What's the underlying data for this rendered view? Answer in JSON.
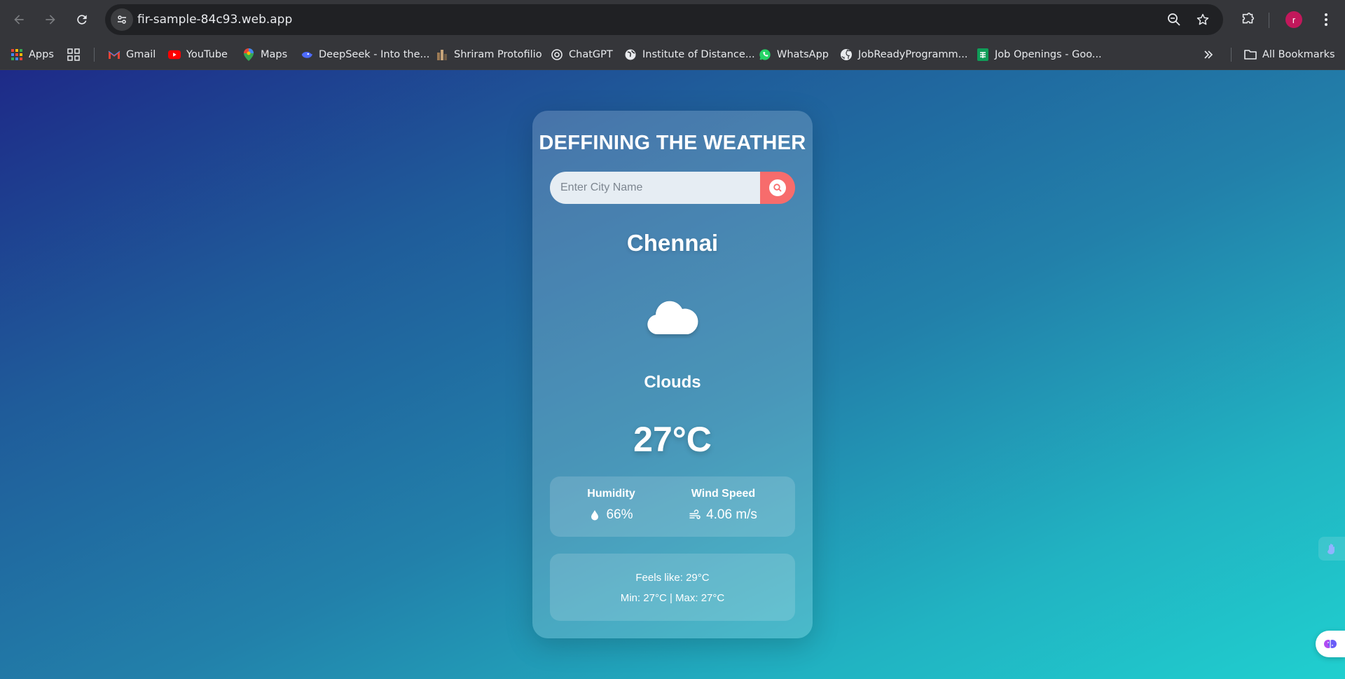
{
  "browser": {
    "url": "fir-sample-84c93.web.app",
    "profile_initial": "r"
  },
  "bookmarks": {
    "apps_label": "Apps",
    "items": [
      {
        "label": "Gmail",
        "icon": "gmail-icon"
      },
      {
        "label": "YouTube",
        "icon": "youtube-icon"
      },
      {
        "label": "Maps",
        "icon": "maps-icon"
      },
      {
        "label": "DeepSeek - Into the...",
        "icon": "deepseek-icon"
      },
      {
        "label": "Shriram Protofilio",
        "icon": "portfolio-icon"
      },
      {
        "label": "ChatGPT",
        "icon": "chatgpt-icon"
      },
      {
        "label": "Institute of Distance...",
        "icon": "globe-icon"
      },
      {
        "label": "WhatsApp",
        "icon": "whatsapp-icon"
      },
      {
        "label": "JobReadyProgramm...",
        "icon": "github-icon"
      },
      {
        "label": "Job Openings - Goo...",
        "icon": "sheets-icon"
      }
    ],
    "all_bookmarks_label": "All Bookmarks"
  },
  "app": {
    "title": "DEFFINING THE WEATHER",
    "search_placeholder": "Enter City Name",
    "city": "Chennai",
    "condition": "Clouds",
    "temperature": "27°C",
    "humidity_label": "Humidity",
    "humidity_value": "66%",
    "wind_label": "Wind Speed",
    "wind_value": "4.06 m/s",
    "feels_like": "Feels like: 29°C",
    "min_max": "Min: 27°C | Max: 27°C"
  },
  "colors": {
    "accent": "#f76c6c",
    "gradient_start": "#1e2a88",
    "gradient_end": "#20cfcf"
  }
}
